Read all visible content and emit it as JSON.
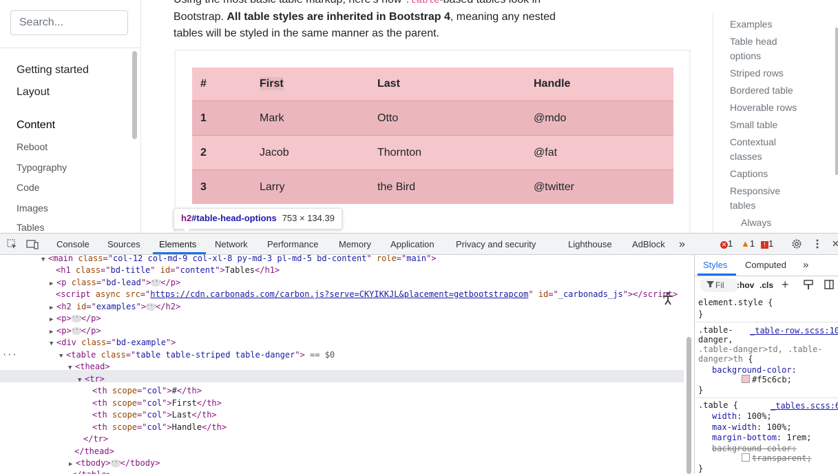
{
  "search": {
    "placeholder": "Search..."
  },
  "sidebar": {
    "items": [
      {
        "label": "Getting started"
      },
      {
        "label": "Layout"
      },
      {
        "label": "Content"
      },
      {
        "label": "Reboot"
      },
      {
        "label": "Typography"
      },
      {
        "label": "Code"
      },
      {
        "label": "Images"
      },
      {
        "label": "Tables"
      }
    ]
  },
  "intro": {
    "line1_start": "Using the most basic table markup, here’s how ",
    "line1_code": ".table",
    "line1_end": "-based tables look in",
    "line2_start": "Bootstrap. ",
    "line2_bold": "All table styles are inherited in Bootstrap 4",
    "line2_end": ", meaning any nested",
    "line3": "tables will be styled in the same manner as the parent."
  },
  "table": {
    "headers": [
      "#",
      "First",
      "Last",
      "Handle"
    ],
    "rows": [
      [
        "1",
        "Mark",
        "Otto",
        "@mdo"
      ],
      [
        "2",
        "Jacob",
        "Thornton",
        "@fat"
      ],
      [
        "3",
        "Larry",
        "the Bird",
        "@twitter"
      ]
    ]
  },
  "tooltip": {
    "tag": "h2",
    "id": "#table-head-options",
    "dims": "753 × 134.39"
  },
  "toc": {
    "items": [
      "Examples",
      "Table head",
      "options",
      "Striped rows",
      "Bordered table",
      "Hoverable rows",
      "Small table",
      "Contextual",
      "classes",
      "Captions",
      "Responsive",
      "tables",
      "Always"
    ]
  },
  "devtools": {
    "tabs": [
      "Console",
      "Sources",
      "Elements",
      "Network",
      "Performance",
      "Memory",
      "Application",
      "Privacy and security",
      "Lighthouse",
      "AdBlock"
    ],
    "more": "»",
    "errors": "1",
    "warnings": "1",
    "issues": "1",
    "dom": {
      "main_class": "col-12 col-md-9 col-xl-8 py-md-3 pl-md-5 bd-content",
      "main_role": "main",
      "h1_class": "bd-title",
      "h1_id": "content",
      "h1_text": "Tables",
      "p_class": "bd-lead",
      "script_src": "https://cdn.carbonads.com/carbon.js?serve=CKYIKKJL&placement=getbootstrapcom",
      "script_id": "_carbonads_js",
      "h2_id": "examples",
      "div_class": "bd-example",
      "table_class": "table table-striped table-danger",
      "selected_marker": "== $0",
      "th": [
        "#",
        "First",
        "Last",
        "Handle"
      ],
      "th_scope": "col"
    },
    "styles": {
      "tabs": [
        "Styles",
        "Computed"
      ],
      "filter": "Fil",
      "hov": ":hov",
      "cls": ".cls",
      "element_style": "element.style {",
      "rule1_sel1": ".table-",
      "rule1_sel2": "danger,",
      "rule1_sel3": ".table-danger>td, .table-",
      "rule1_sel4": "danger>th {",
      "rule1_src": "_table-row.scss:10",
      "rule1_prop": "background-color",
      "rule1_val": "#f5c6cb;",
      "rule2_sel": ".table {",
      "rule2_src": "_tables.scss:6",
      "rule2_props": [
        {
          "name": "width",
          "val": "100%;"
        },
        {
          "name": "max-width",
          "val": "100%;"
        },
        {
          "name": "margin-bottom",
          "val": "1rem;"
        }
      ],
      "rule2_strike_prop": "background-color:",
      "rule2_strike_val": "transparent;"
    }
  },
  "colors": {
    "accent": "#1a73e8",
    "table_bg": "#f5c6cb",
    "table_stripe": "#ebb7bd",
    "error": "#d93025",
    "warning": "#e37400"
  }
}
